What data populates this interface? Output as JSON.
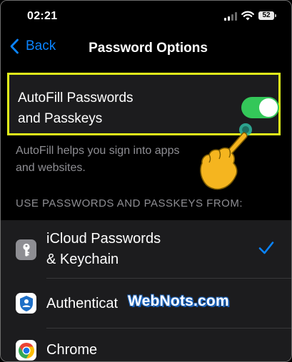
{
  "status_bar": {
    "time": "02:21",
    "battery": "52"
  },
  "nav": {
    "back_label": "Back",
    "title": "Password Options"
  },
  "autofill": {
    "label_line1": "AutoFill Passwords",
    "label_line2": "and Passkeys",
    "enabled": true,
    "helper_line1": "AutoFill helps you sign into apps",
    "helper_line2": "and websites."
  },
  "section_header": "USE PASSWORDS AND PASSKEYS FROM:",
  "providers": [
    {
      "line1": "iCloud Passwords",
      "line2": "& Keychain",
      "selected": true,
      "icon": "key-icon"
    },
    {
      "line1": "Authenticat",
      "selected": false,
      "icon": "authenticator-icon"
    },
    {
      "line1": "Chrome",
      "selected": false,
      "icon": "chrome-icon"
    }
  ],
  "watermark": "WebNots.com",
  "colors": {
    "accent": "#0a84ff",
    "toggle_on": "#34c759",
    "highlight_border": "#e1f41b",
    "row_background": "#1c1c1e",
    "secondary_text": "#8e8e93",
    "pointer_hand": "#f5b51f"
  }
}
